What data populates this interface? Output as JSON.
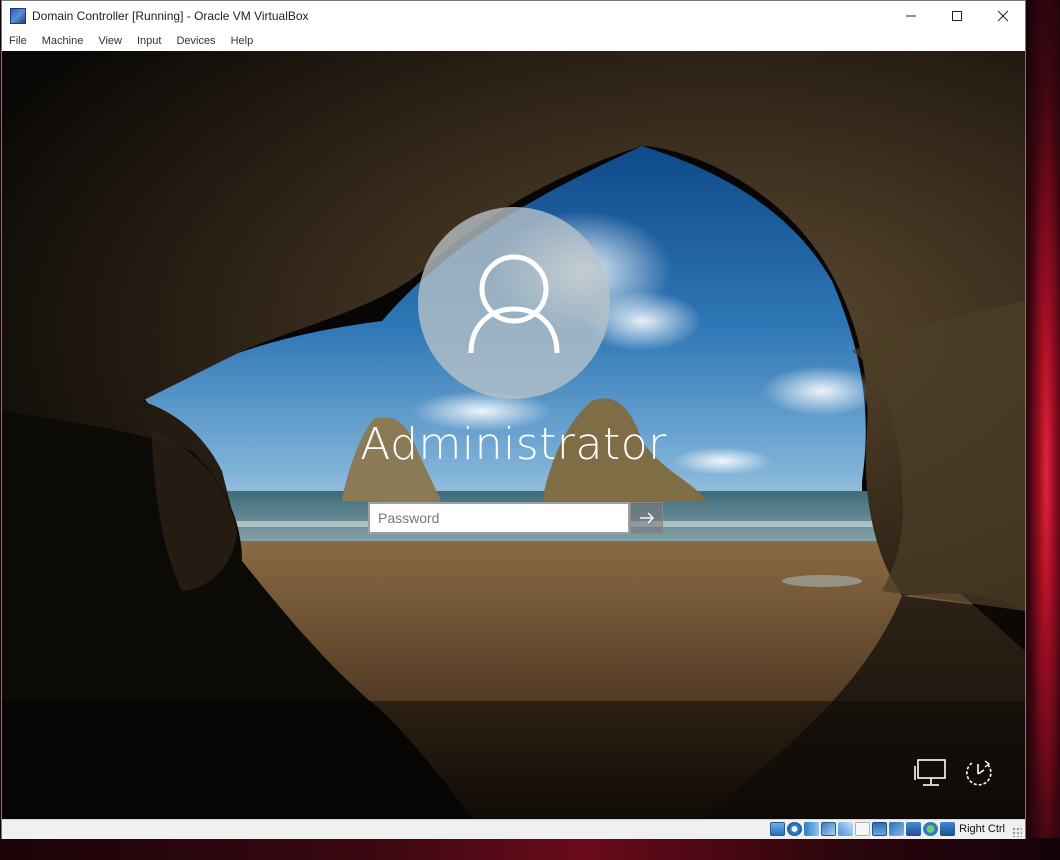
{
  "window": {
    "title": "Domain Controller [Running] - Oracle VM VirtualBox",
    "icon": "virtualbox-icon",
    "controls": [
      "minimize-icon",
      "maximize-icon",
      "close-icon"
    ]
  },
  "menubar": {
    "items": [
      "File",
      "Machine",
      "View",
      "Input",
      "Devices",
      "Help"
    ]
  },
  "login": {
    "user_name": "Administrator",
    "password_placeholder": "Password",
    "submit_icon": "arrow-right-icon",
    "avatar_icon": "user-icon"
  },
  "corner_icons": {
    "network": "network-icon",
    "power": "power-icon"
  },
  "statusbar": {
    "host_key": "Right Ctrl",
    "icons": [
      "hard-disk-icon",
      "optical-drive-icon",
      "audio-icon",
      "network-icon",
      "usb-icon",
      "shared-folders-icon",
      "display-icon",
      "video-capture-icon",
      "cpu-icon",
      "guest-additions-icon",
      "mouse-integration-icon"
    ]
  },
  "colors": {
    "accent": "#2a5fb0",
    "login_text": "#ffffff",
    "statusbar_bg": "#f0f0f0"
  }
}
